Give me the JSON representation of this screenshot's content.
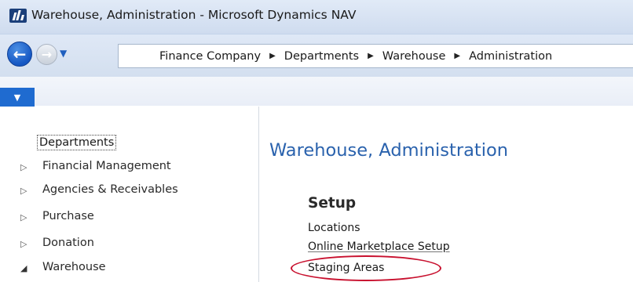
{
  "window": {
    "title": "Warehouse, Administration - Microsoft Dynamics NAV",
    "logo_icon": "dynamics-nav-logo-icon"
  },
  "navigation": {
    "back_icon": "back-arrow-icon",
    "forward_icon": "forward-arrow-icon",
    "history_icon": "chevron-down-icon",
    "breadcrumb": [
      "Finance Company",
      "Departments",
      "Warehouse",
      "Administration"
    ]
  },
  "ribbon": {
    "menu_icon": "chevron-down-icon"
  },
  "departments_tree": {
    "root_label": "Departments",
    "items": [
      {
        "label": "Financial Management",
        "state": "collapsed"
      },
      {
        "label": "Agencies & Receivables",
        "state": "collapsed"
      },
      {
        "label": "Purchase",
        "state": "collapsed"
      },
      {
        "label": "Donation",
        "state": "collapsed"
      },
      {
        "label": "Warehouse",
        "state": "expanded"
      }
    ]
  },
  "main": {
    "page_title": "Warehouse, Administration",
    "sections": [
      {
        "header": "Setup",
        "links": [
          "Locations",
          "Online Marketplace Setup",
          "Staging Areas"
        ]
      }
    ]
  },
  "colors": {
    "title_blue": "#2a62ad",
    "accent_blue": "#1f6bd0",
    "highlight_red": "#c8102e"
  }
}
